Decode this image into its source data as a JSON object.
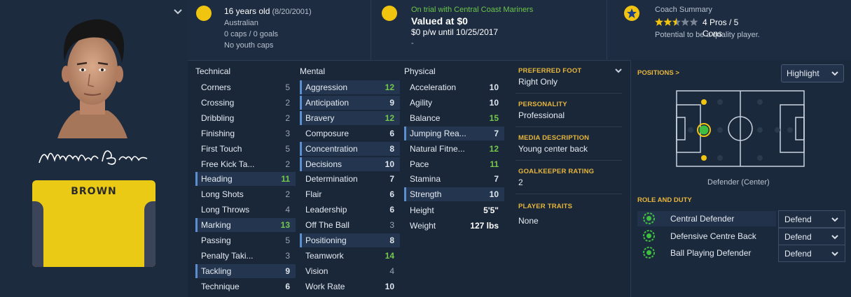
{
  "player": {
    "surname_on_shirt": "BROWN",
    "age_text": "16 years old",
    "dob": "(8/20/2001)",
    "nationality": "Australian",
    "caps": "0 caps / 0 goals",
    "youth_caps": "No youth caps"
  },
  "contract": {
    "status": "On trial with Central Coast Mariners",
    "valued": "Valued at $0",
    "wage": "$0 p/w until 10/25/2017",
    "extra": "-"
  },
  "coach": {
    "title": "Coach Summary",
    "stars": 2.5,
    "stars_max": 5,
    "pros_cons": "4 Pros / 5 Cons",
    "summary": "Potential to be a quality player."
  },
  "attributes": {
    "technical": {
      "title": "Technical",
      "items": [
        {
          "name": "Corners",
          "value": "5",
          "highlight": false
        },
        {
          "name": "Crossing",
          "value": "2",
          "highlight": false
        },
        {
          "name": "Dribbling",
          "value": "2",
          "highlight": false
        },
        {
          "name": "Finishing",
          "value": "3",
          "highlight": false
        },
        {
          "name": "First Touch",
          "value": "5",
          "highlight": false
        },
        {
          "name": "Free Kick Ta...",
          "value": "2",
          "highlight": false
        },
        {
          "name": "Heading",
          "value": "11",
          "highlight": true
        },
        {
          "name": "Long Shots",
          "value": "2",
          "highlight": false
        },
        {
          "name": "Long Throws",
          "value": "4",
          "highlight": false
        },
        {
          "name": "Marking",
          "value": "13",
          "highlight": true
        },
        {
          "name": "Passing",
          "value": "5",
          "highlight": false
        },
        {
          "name": "Penalty Taki...",
          "value": "3",
          "highlight": false
        },
        {
          "name": "Tackling",
          "value": "9",
          "highlight": true
        },
        {
          "name": "Technique",
          "value": "6",
          "highlight": false
        }
      ]
    },
    "mental": {
      "title": "Mental",
      "items": [
        {
          "name": "Aggression",
          "value": "12",
          "highlight": true
        },
        {
          "name": "Anticipation",
          "value": "9",
          "highlight": true
        },
        {
          "name": "Bravery",
          "value": "12",
          "highlight": true
        },
        {
          "name": "Composure",
          "value": "6",
          "highlight": false
        },
        {
          "name": "Concentration",
          "value": "8",
          "highlight": true
        },
        {
          "name": "Decisions",
          "value": "10",
          "highlight": true
        },
        {
          "name": "Determination",
          "value": "7",
          "highlight": false
        },
        {
          "name": "Flair",
          "value": "6",
          "highlight": false
        },
        {
          "name": "Leadership",
          "value": "6",
          "highlight": false
        },
        {
          "name": "Off The Ball",
          "value": "3",
          "highlight": false
        },
        {
          "name": "Positioning",
          "value": "8",
          "highlight": true
        },
        {
          "name": "Teamwork",
          "value": "14",
          "highlight": false
        },
        {
          "name": "Vision",
          "value": "4",
          "highlight": false
        },
        {
          "name": "Work Rate",
          "value": "10",
          "highlight": false
        }
      ]
    },
    "physical": {
      "title": "Physical",
      "items": [
        {
          "name": "Acceleration",
          "value": "10",
          "highlight": false
        },
        {
          "name": "Agility",
          "value": "10",
          "highlight": false
        },
        {
          "name": "Balance",
          "value": "15",
          "highlight": false
        },
        {
          "name": "Jumping Rea...",
          "value": "7",
          "highlight": true
        },
        {
          "name": "Natural Fitne...",
          "value": "12",
          "highlight": false
        },
        {
          "name": "Pace",
          "value": "11",
          "highlight": false
        },
        {
          "name": "Stamina",
          "value": "7",
          "highlight": false
        },
        {
          "name": "Strength",
          "value": "10",
          "highlight": true
        }
      ],
      "height_label": "Height",
      "height_value": "5'5\"",
      "weight_label": "Weight",
      "weight_value": "127 lbs"
    }
  },
  "details": {
    "preferred_foot_label": "PREFERRED FOOT",
    "preferred_foot": "Right Only",
    "personality_label": "PERSONALITY",
    "personality": "Professional",
    "media_label": "MEDIA DESCRIPTION",
    "media": "Young center back",
    "gk_label": "GOALKEEPER RATING",
    "gk": "2",
    "traits_label": "PLAYER TRAITS",
    "traits": "None"
  },
  "positions": {
    "title": "POSITIONS >",
    "highlight_label": "Highlight",
    "position_caption": "Defender (Center)",
    "role_title": "ROLE AND DUTY",
    "roles": [
      {
        "name": "Central Defender",
        "duty": "Defend"
      },
      {
        "name": "Defensive Centre Back",
        "duty": "Defend"
      },
      {
        "name": "Ball Playing Defender",
        "duty": "Defend"
      }
    ]
  },
  "colors": {
    "accent_gold": "#e7b63b",
    "good_green": "#74c84c",
    "shirt_yellow": "#eaca15"
  }
}
